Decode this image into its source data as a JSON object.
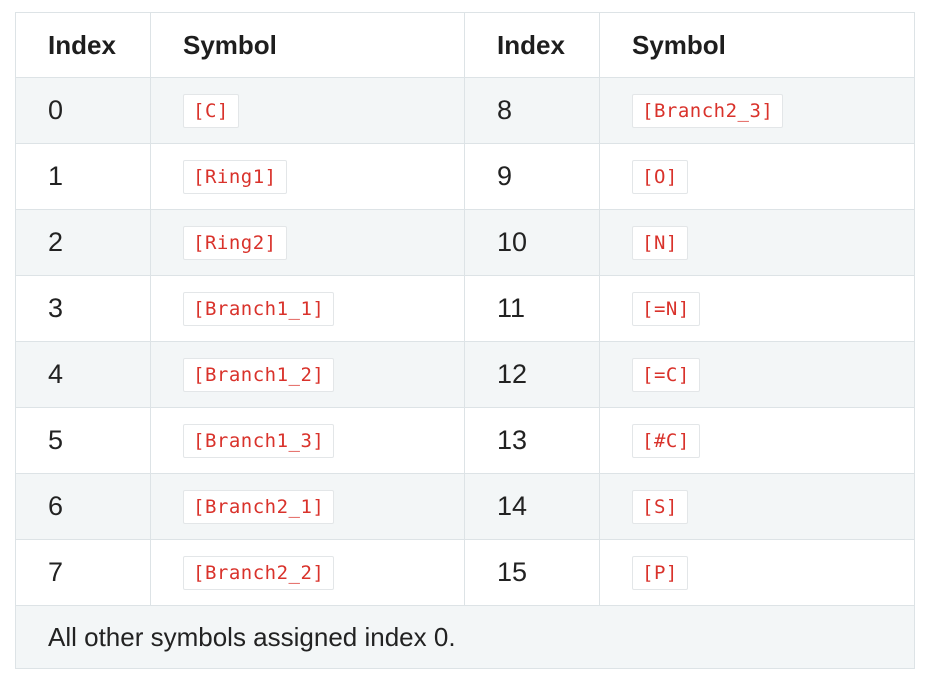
{
  "table": {
    "headers": [
      "Index",
      "Symbol",
      "Index",
      "Symbol"
    ],
    "rows": [
      {
        "left_index": "0",
        "left_symbol": "[C]",
        "right_index": "8",
        "right_symbol": "[Branch2_3]"
      },
      {
        "left_index": "1",
        "left_symbol": "[Ring1]",
        "right_index": "9",
        "right_symbol": "[O]"
      },
      {
        "left_index": "2",
        "left_symbol": "[Ring2]",
        "right_index": "10",
        "right_symbol": "[N]"
      },
      {
        "left_index": "3",
        "left_symbol": "[Branch1_1]",
        "right_index": "11",
        "right_symbol": "[=N]"
      },
      {
        "left_index": "4",
        "left_symbol": "[Branch1_2]",
        "right_index": "12",
        "right_symbol": "[=C]"
      },
      {
        "left_index": "5",
        "left_symbol": "[Branch1_3]",
        "right_index": "13",
        "right_symbol": "[#C]"
      },
      {
        "left_index": "6",
        "left_symbol": "[Branch2_1]",
        "right_index": "14",
        "right_symbol": "[S]"
      },
      {
        "left_index": "7",
        "left_symbol": "[Branch2_2]",
        "right_index": "15",
        "right_symbol": "[P]"
      }
    ],
    "footnote": "All other symbols assigned index 0."
  },
  "colors": {
    "code_text": "#d9322b",
    "stripe": "#f3f6f7",
    "border": "#dde3e6"
  }
}
